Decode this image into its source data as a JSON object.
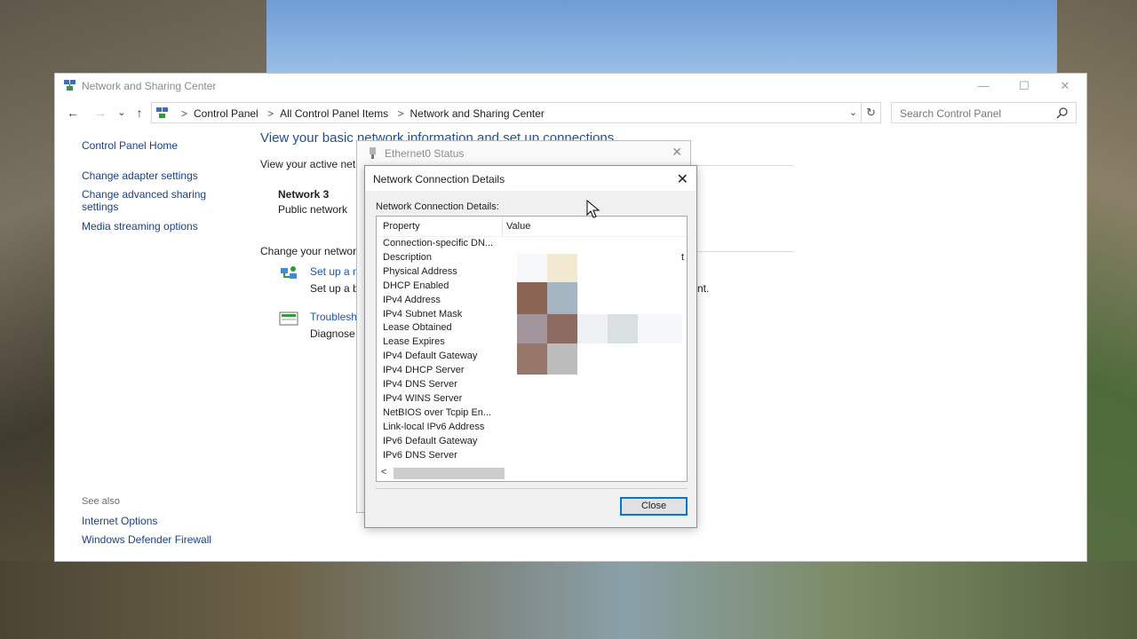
{
  "window": {
    "title": "Network and Sharing Center",
    "minimize": "—",
    "maximize": "☐",
    "close": "✕"
  },
  "nav": {
    "back": "←",
    "forward": "→",
    "recent": "⌄",
    "up": "↑",
    "refresh": "↻",
    "dropdown": "⌄"
  },
  "breadcrumb": [
    "Control Panel",
    "All Control Panel Items",
    "Network and Sharing Center"
  ],
  "search": {
    "placeholder": "Search Control Panel"
  },
  "sidebar": {
    "items": [
      "Control Panel Home",
      "Change adapter settings",
      "Change advanced sharing settings",
      "Media streaming options"
    ],
    "see_also_label": "See also",
    "see_also": [
      "Internet Options",
      "Windows Defender Firewall"
    ]
  },
  "main": {
    "heading": "View your basic network information and set up connections",
    "active_networks": "View your active net",
    "network_name": "Network 3",
    "network_type": "Public network",
    "change_heading": "Change your networ",
    "tasks": [
      {
        "link": "Set up a n",
        "desc": "Set up a b",
        "tail": "nt."
      },
      {
        "link": "Troublesh",
        "desc": "Diagnose"
      }
    ]
  },
  "status_dialog": {
    "title": "Ethernet0 Status",
    "close": "✕"
  },
  "details_dialog": {
    "title": "Network Connection Details",
    "close": "✕",
    "label": "Network Connection Details:",
    "columns": [
      "Property",
      "Value"
    ],
    "rows": [
      "Connection-specific DN...",
      "Description",
      "Physical Address",
      "DHCP Enabled",
      "IPv4 Address",
      "IPv4 Subnet Mask",
      "Lease Obtained",
      "Lease Expires",
      "IPv4 Default Gateway",
      "IPv4 DHCP Server",
      "IPv4 DNS Server",
      "IPv4 WINS Server",
      "NetBIOS over Tcpip En...",
      "Link-local IPv6 Address",
      "IPv6 Default Gateway",
      "IPv6 DNS Server"
    ],
    "description_tail": "t",
    "scroll_left": "<",
    "close_button": "Close"
  }
}
